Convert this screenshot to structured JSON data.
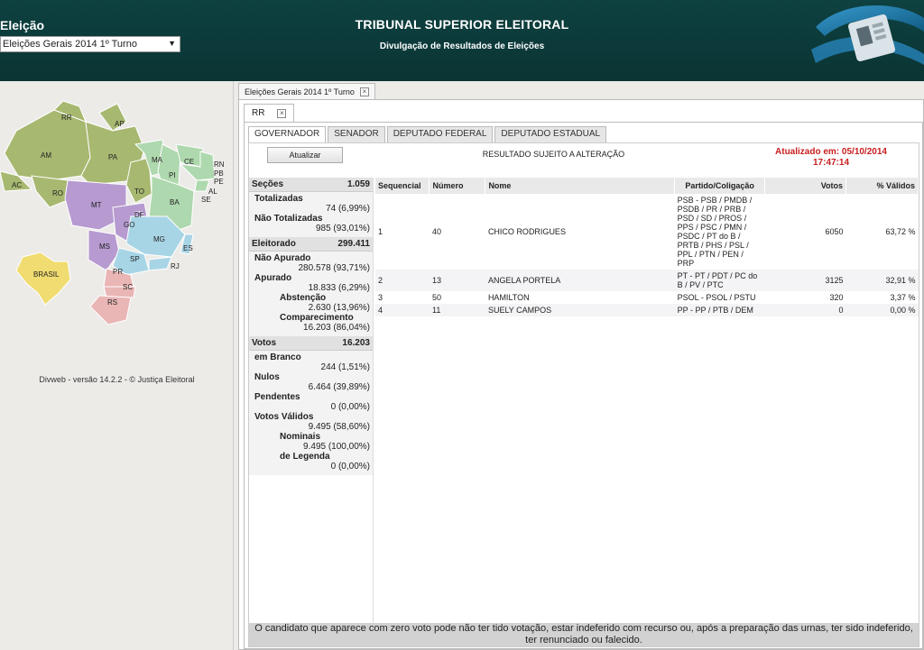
{
  "header": {
    "election_label": "Eleição",
    "election_select": "Eleições Gerais 2014 1º Turno",
    "title": "TRIBUNAL SUPERIOR ELEITORAL",
    "subtitle": "Divulgação de Resultados de Eleições"
  },
  "map": {
    "states": [
      "RR",
      "AP",
      "AM",
      "PA",
      "MA",
      "CE",
      "RN",
      "PB",
      "PE",
      "AL",
      "SE",
      "PI",
      "AC",
      "RO",
      "TO",
      "BA",
      "MT",
      "DF",
      "GO",
      "MG",
      "ES",
      "MS",
      "SP",
      "RJ",
      "PR",
      "SC",
      "RS"
    ],
    "brasil_label": "BRASIL"
  },
  "version": "Divweb - versão 14.2.2 - © Justiça Eleitoral",
  "outer_tab": {
    "label": "Eleições Gerais 2014 1º Turno",
    "close": "×"
  },
  "state_tab": {
    "label": "RR",
    "close": "×"
  },
  "tabs": [
    "GOVERNADOR",
    "SENADOR",
    "DEPUTADO FEDERAL",
    "DEPUTADO ESTADUAL"
  ],
  "toolbar": {
    "refresh_label": "Atualizar",
    "notice": "RESULTADO SUJEITO A ALTERAÇÃO",
    "updated_line1": "Atualizado em: 05/10/2014",
    "updated_line2": "17:47:14"
  },
  "stats": {
    "secoes": {
      "label": "Seções",
      "value": "1.059",
      "totalizadas_label": "Totalizadas",
      "totalizadas_value": "74 (6,99%)",
      "nao_totalizadas_label": "Não Totalizadas",
      "nao_totalizadas_value": "985 (93,01%)"
    },
    "eleitorado": {
      "label": "Eleitorado",
      "value": "299.411",
      "nao_apurado_label": "Não Apurado",
      "nao_apurado_value": "280.578 (93,71%)",
      "apurado_label": "Apurado",
      "apurado_value": "18.833 (6,29%)",
      "abstencao_label": "Abstenção",
      "abstencao_value": "2.630 (13,96%)",
      "comparecimento_label": "Comparecimento",
      "comparecimento_value": "16.203 (86,04%)"
    },
    "votos": {
      "label": "Votos",
      "value": "16.203",
      "branco_label": "em Branco",
      "branco_value": "244 (1,51%)",
      "nulos_label": "Nulos",
      "nulos_value": "6.464 (39,89%)",
      "pendentes_label": "Pendentes",
      "pendentes_value": "0 (0,00%)",
      "validos_label": "Votos Válidos",
      "validos_value": "9.495 (58,60%)",
      "nominais_label": "Nominais",
      "nominais_value": "9.495 (100,00%)",
      "legenda_label": "de Legenda",
      "legenda_value": "0 (0,00%)"
    }
  },
  "table": {
    "columns": [
      "Sequencial",
      "Número",
      "Nome",
      "Partido/Coligação",
      "Votos",
      "% Válidos"
    ],
    "rows": [
      {
        "seq": "1",
        "num": "40",
        "name": "CHICO RODRIGUES",
        "party": "PSB - PSB / PMDB / PSDB / PR / PRB / PSD / SD / PROS / PPS / PSC / PMN / PSDC / PT do B / PRTB / PHS / PSL / PPL / PTN / PEN / PRP",
        "votes": "6050",
        "pct": "63,72 %"
      },
      {
        "seq": "2",
        "num": "13",
        "name": "ANGELA PORTELA",
        "party": "PT - PT / PDT / PC do B / PV / PTC",
        "votes": "3125",
        "pct": "32,91 %"
      },
      {
        "seq": "3",
        "num": "50",
        "name": "HAMILTON",
        "party": "PSOL - PSOL / PSTU",
        "votes": "320",
        "pct": "3,37 %"
      },
      {
        "seq": "4",
        "num": "11",
        "name": "SUELY CAMPOS",
        "party": "PP - PP / PTB / DEM",
        "votes": "0",
        "pct": "0,00 %"
      }
    ]
  },
  "footer_note": "O candidato que aparece com zero voto pode não ter tido votação, estar indeferido com recurso ou, após a preparação das urnas, ter sido indeferido, ter renunciado ou falecido."
}
